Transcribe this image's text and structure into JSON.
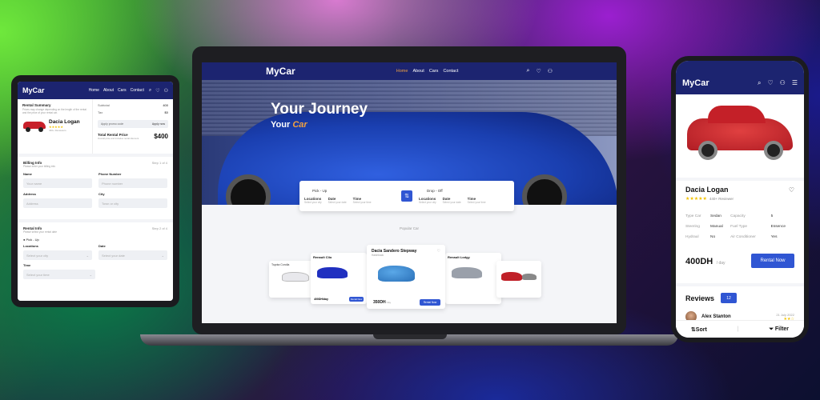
{
  "tablet": {
    "logo": "MyCar",
    "nav": [
      "Home",
      "About",
      "Cars",
      "Contact"
    ],
    "summary_title": "Rental Summary",
    "summary_desc": "Prices may change depending on the length of the rental and the price of your rental car.",
    "car_name": "Dacia Logan",
    "reviews": "440+ Reviewers",
    "subtotal_label": "Subtotal",
    "subtotal_value": "400",
    "tax_label": "Tax",
    "tax_value": "$0",
    "promo_placeholder": "Apply promo code",
    "promo_button": "Apply now",
    "total_label": "Total Rental Price",
    "total_desc": "Overall price and includes rental discount",
    "total_value": "$400",
    "billing_title": "Billing Info",
    "billing_desc": "Please enter your billing info",
    "billing_step": "Step 1 of 4",
    "name_label": "Name",
    "name_placeholder": "Your name",
    "phone_label": "Phone Number",
    "phone_placeholder": "Phone number",
    "address_label": "Address",
    "address_placeholder": "Address",
    "city_label": "City",
    "city_placeholder": "Town or city",
    "rental_title": "Rental Info",
    "rental_desc": "Please select your rental date",
    "rental_step": "Step 2 of 4",
    "pickup_label": "Pick - Up",
    "locations_label": "Locations",
    "locations_placeholder": "Select your city",
    "date_label": "Date",
    "date_placeholder": "Select your date",
    "time_label": "Time",
    "time_placeholder": "Select your time"
  },
  "laptop": {
    "logo": "MyCar",
    "nav": [
      "Home",
      "About",
      "Cars",
      "Contact"
    ],
    "hero_title": "Your Journey",
    "hero_sub_a": "Your",
    "hero_sub_b": "Car",
    "pickup": "Pick - Up",
    "dropoff": "Drop - Off",
    "locations": "Locations",
    "date": "Date",
    "time": "Time",
    "select_city": "Select your city",
    "select_date": "Select your date",
    "select_time": "Select your time",
    "popular": "Popular Car",
    "cards": [
      {
        "name": "Toyota Corolla",
        "price": "",
        "button": ""
      },
      {
        "name": "Renault Clio",
        "price": "400DH/day",
        "button": "Rental Now"
      },
      {
        "name": "Dacia Sandero Stepway",
        "price": "350DH",
        "per": "/ day",
        "button": "Rental Now",
        "type": "Hatchback"
      },
      {
        "name": "Renault Lodgy",
        "price": "",
        "button": ""
      },
      {
        "name": "",
        "price": "",
        "button": ""
      }
    ],
    "colors": {
      "navy": "#1c2470",
      "accent": "#3056d3",
      "highlight": "#f0a040"
    }
  },
  "phone": {
    "logo": "MyCar",
    "car_name": "Dacia Logan",
    "reviews": "440+ Reviewer",
    "specs": [
      [
        "Type Car",
        "Sedan",
        "Capacity",
        "5"
      ],
      [
        "Steering",
        "Manual",
        "Fuel Type",
        "Essence"
      ],
      [
        "Hydraul",
        "No",
        "Air Conditioner",
        "Yes"
      ]
    ],
    "price": "400DH",
    "per_day": "/ day",
    "rent_button": "Rental Now",
    "reviews_title": "Reviews",
    "reviews_count": "12",
    "reviewer_name": "Alex Stanton",
    "reviewer_date": "21 July 2022",
    "sort_label": "Sort",
    "filter_label": "Filter"
  }
}
